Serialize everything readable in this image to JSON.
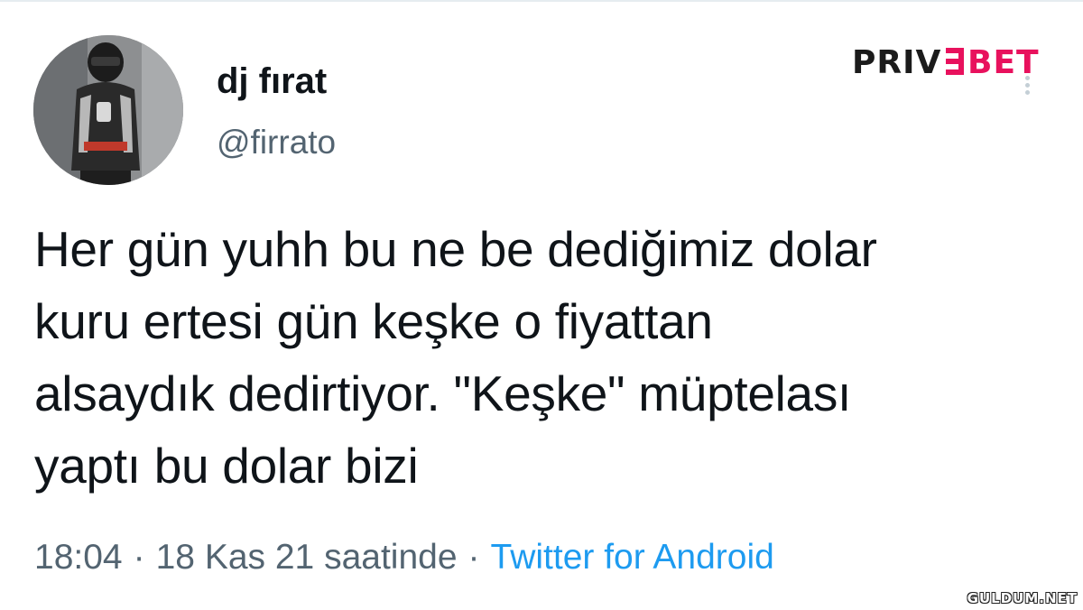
{
  "author": {
    "display_name": "dj fırat",
    "handle": "@firrato",
    "avatar_icon": "avatar-photo"
  },
  "tweet": {
    "text": "Her gün yuhh bu ne be dediğimiz dolar\nkuru ertesi gün keşke o fiyattan\nalsaydık dedirtiyor. \"Keşke\" müptelası\nyaptı bu dolar bizi"
  },
  "meta": {
    "time": "18:04",
    "date": "18 Kas 21 saatinde",
    "separator": "·",
    "source": "Twitter for Android"
  },
  "brand": {
    "logo_text": "PRIVEBET",
    "colors": {
      "dark": "#1b1b1b",
      "accent": "#e8115d"
    }
  },
  "watermark": {
    "text": "GULDUM.NET"
  },
  "colors": {
    "text_primary": "#0f1419",
    "text_secondary": "#536471",
    "link": "#1d9bf0"
  }
}
